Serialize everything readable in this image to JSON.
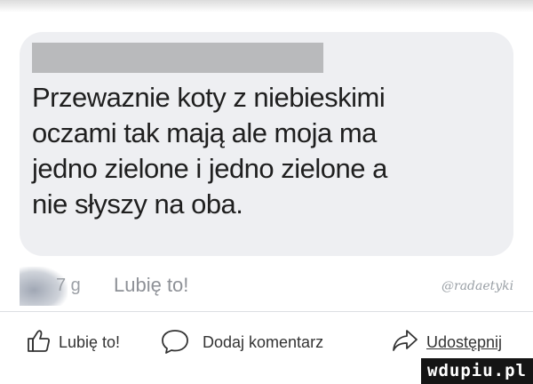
{
  "comment": {
    "text": "Przewaznie koty z niebieskimi\noczami tak mają ale moja ma\njedno zielone i jedno zielone a\nnie słyszy na oba.",
    "time": "7 g",
    "like_label": "Lubię to!",
    "watermark": "@radaetyki"
  },
  "actions": {
    "like": "Lubię to!",
    "comment": "Dodaj komentarz",
    "share": "Udostępnij"
  },
  "site_watermark": "wdupiu.pl",
  "icons": {
    "like": "thumbs-up-icon",
    "comment": "speech-bubble-icon",
    "share": "share-arrow-icon"
  },
  "colors": {
    "bubble": "#eeeff2",
    "text": "#1f1f1f",
    "meta": "#8e9197"
  }
}
